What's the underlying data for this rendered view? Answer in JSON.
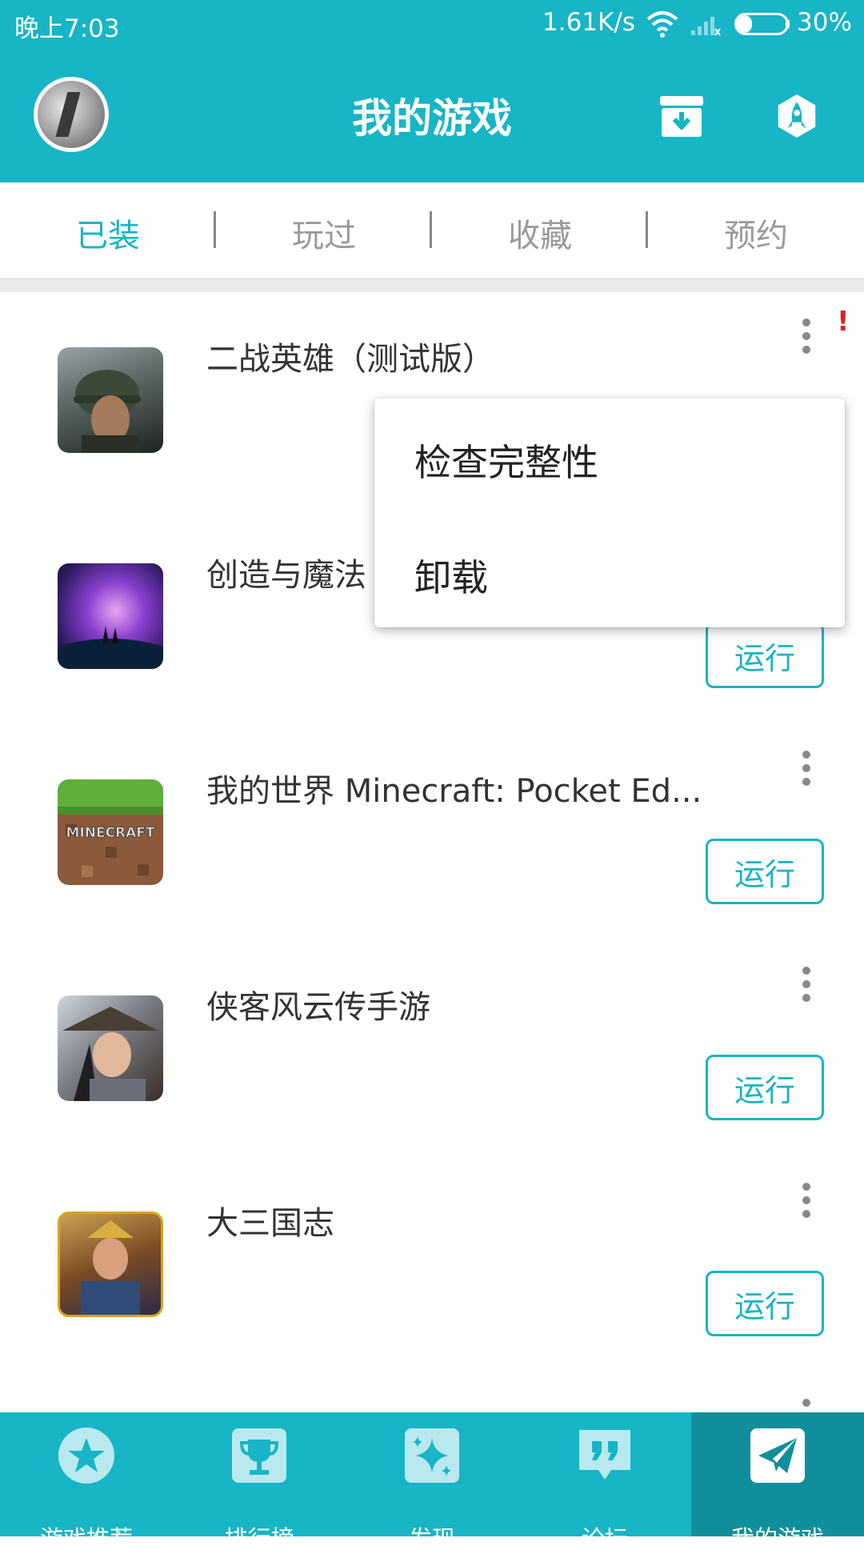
{
  "status_bar": {
    "time": "晚上7:03",
    "net_speed": "1.61K/s",
    "battery_percent_text": "30%",
    "battery_level": 0.3
  },
  "header": {
    "title": "我的游戏",
    "icons": [
      "avatar",
      "download-box-icon",
      "rocket-icon"
    ]
  },
  "tabs": [
    {
      "label": "已装",
      "active": true
    },
    {
      "label": "玩过",
      "active": false
    },
    {
      "label": "收藏",
      "active": false
    },
    {
      "label": "预约",
      "active": false
    }
  ],
  "games": [
    {
      "name": "二战英雄（测试版）",
      "button": "",
      "alert_mark": "!"
    },
    {
      "name": "创造与魔法",
      "button": "运行"
    },
    {
      "name": "我的世界 Minecraft: Pocket Ed...",
      "button": "运行",
      "icon_text": "MINECRAFT"
    },
    {
      "name": "侠客风云传手游",
      "button": "运行"
    },
    {
      "name": "大三国志",
      "button": "运行"
    }
  ],
  "popup_menu": {
    "items": [
      "检查完整性",
      "卸载"
    ]
  },
  "bottom_nav": [
    {
      "label": "游戏推荐",
      "icon": "star-icon",
      "active": false
    },
    {
      "label": "排行榜",
      "icon": "trophy-icon",
      "active": false
    },
    {
      "label": "发现",
      "icon": "sparkle-icon",
      "active": false
    },
    {
      "label": "论坛",
      "icon": "quote-icon",
      "active": false
    },
    {
      "label": "我的游戏",
      "icon": "paper-plane-icon",
      "active": true
    }
  ],
  "colors": {
    "accent": "#17b5c6",
    "accent_dark": "#118e9c",
    "alert": "#e02020"
  }
}
